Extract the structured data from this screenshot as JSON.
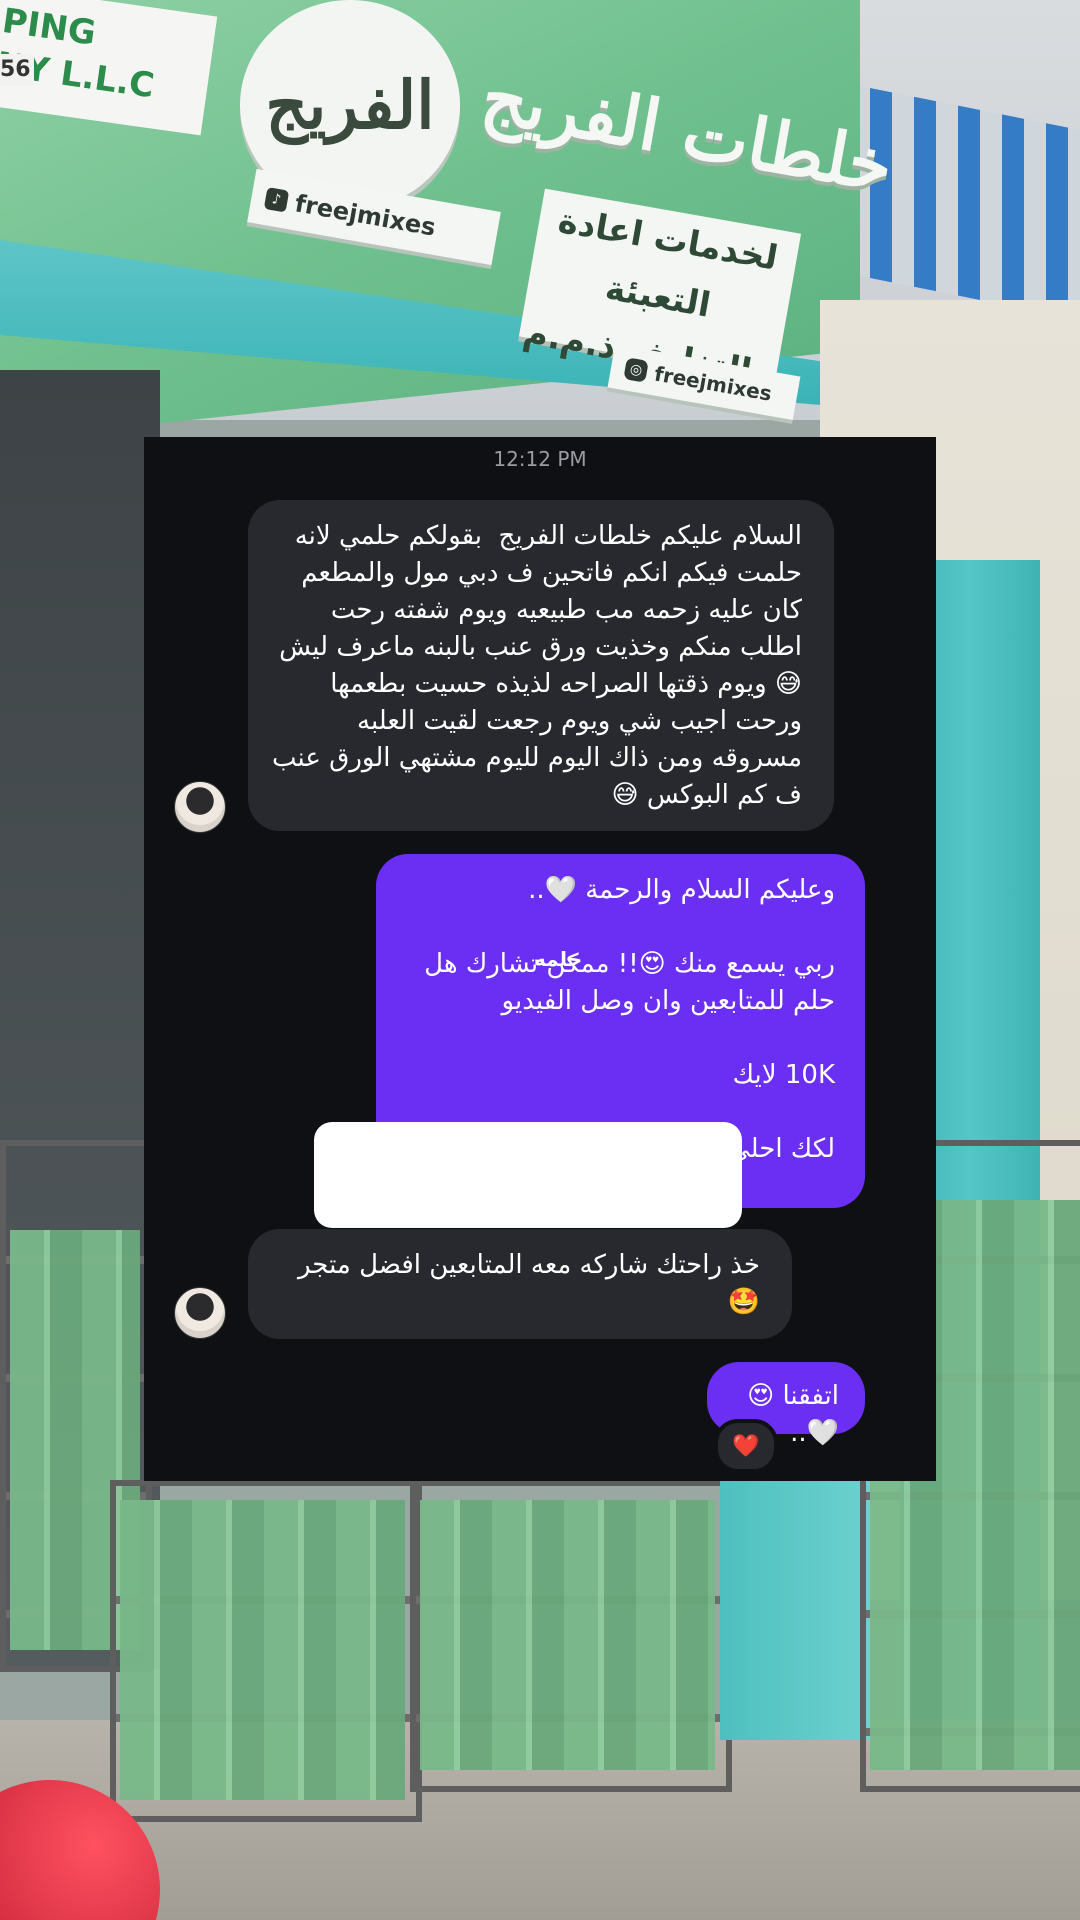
{
  "background": {
    "sign_round_text": "الفريج",
    "sign_big_text": "خلطات الفريج",
    "sign_board_line1": "لخدمات اعادة التعبئة",
    "sign_board_line2": "والتغليف ذ.م.م",
    "handle": "freejmixes",
    "sign_llc_line1": "PING",
    "sign_llc_line2": "NY L.L.C",
    "sign_llc_number": "56"
  },
  "chat": {
    "timestamp": "12:12 PM",
    "messages": [
      {
        "side": "received",
        "text": "السلام عليكم خلطات الفريج  بقولكم حلمي لانه حلمت فيكم انكم فاتحين ف دبي مول والمطعم كان عليه زحمه مب طبيعيه ويوم شفته رحت اطلب منكم وخذيت ورق عنب بالبنه ماعرف ليش 😅 ويوم ذقتها الصراحه لذيذه حسيت بطعمها ورحت اجيب شي ويوم رجعت لقيت العلبه مسروقه ومن ذاك اليوم لليوم مشتهي الورق عنب ف كم البوكس 😅"
      },
      {
        "side": "sent",
        "text": "وعليكم السلام والرحمة 🤍..\n\nربي يسمع منك 😍!! ممكن تشارك هل حلم للمتابعين وان وصل الفيديو\n\n10K لايك\n\nلكك احلى"
      },
      {
        "side": "received",
        "text": "خذ راحتك شاركه معه المتابعين افضل متجر 🤩"
      },
      {
        "side": "sent",
        "text": "اتفقنا 😍🤍.."
      }
    ],
    "overlay_word": "حلمه",
    "reaction": "❤️"
  }
}
